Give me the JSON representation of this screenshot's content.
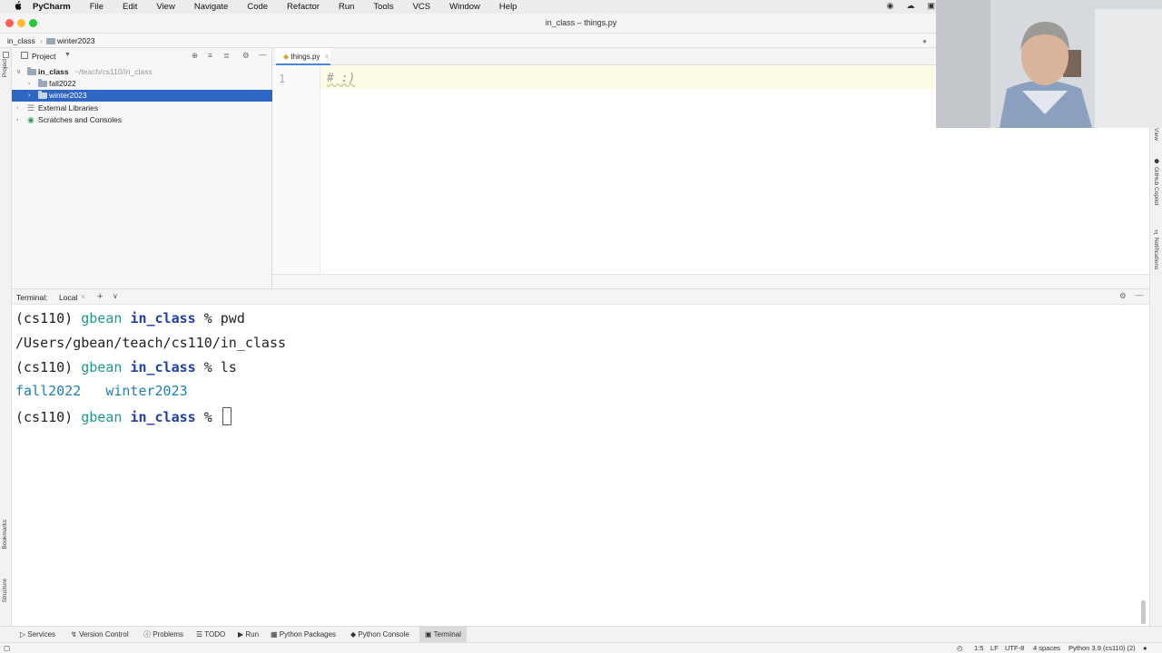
{
  "menubar": {
    "apple": "",
    "app_name": "PyCharm",
    "items": [
      "File",
      "Edit",
      "View",
      "Navigate",
      "Code",
      "Refactor",
      "Run",
      "Tools",
      "VCS",
      "Window",
      "Help"
    ]
  },
  "window": {
    "title": "in_class – things.py"
  },
  "navbar": {
    "breadcrumb_root": "in_class",
    "breadcrumb_child": "winter2023"
  },
  "project_panel": {
    "title": "Project",
    "tree": {
      "root_name": "in_class",
      "root_path": "~/teach/cs110/in_class",
      "folders": [
        "fall2022",
        "winter2023"
      ],
      "external_libraries": "External Libraries",
      "scratches": "Scratches and Consoles"
    }
  },
  "left_stripe": {
    "project": "Project",
    "bookmarks": "Bookmarks",
    "structure": "Structure"
  },
  "right_stripe": {
    "copilot": "GitHub Copilot",
    "notifications": "Notifications",
    "view": "View"
  },
  "editor": {
    "tab_label": "things.py",
    "line_number": "1",
    "code": "# :)"
  },
  "terminal": {
    "header_label": "Terminal:",
    "tab_local": "Local",
    "lines": [
      {
        "env": "(cs110)",
        "user": "gbean",
        "dir": "in_class",
        "prompt": "%",
        "cmd": "pwd"
      },
      {
        "output": "/Users/gbean/teach/cs110/in_class"
      },
      {
        "env": "(cs110)",
        "user": "gbean",
        "dir": "in_class",
        "prompt": "%",
        "cmd": "ls"
      },
      {
        "files": [
          "fall2022",
          "winter2023"
        ]
      },
      {
        "env": "(cs110)",
        "user": "gbean",
        "dir": "in_class",
        "prompt": "%",
        "cmd": ""
      }
    ]
  },
  "bottom_tabs": [
    "Services",
    "Version Control",
    "Problems",
    "TODO",
    "Run",
    "Python Packages",
    "Python Console",
    "Terminal"
  ],
  "status_bar": {
    "position": "1:5",
    "line_sep": "LF",
    "encoding": "UTF-8",
    "indent": "4 spaces",
    "interpreter": "Python 3.9 (cs110) (2)"
  },
  "colors": {
    "selection": "#2e66c4",
    "folder": "#9aa7b6",
    "terminal_user": "#1c9a8a",
    "terminal_dir": "#1f3ea8"
  }
}
